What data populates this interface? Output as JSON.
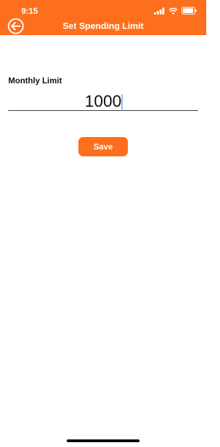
{
  "status_bar": {
    "time": "9:15",
    "icons": [
      "cellular-signal-icon",
      "wifi-icon",
      "battery-icon"
    ]
  },
  "header": {
    "title": "Set Spending Limit",
    "back_icon": "back-arrow-circle-icon",
    "background_color": "#fd6f1c"
  },
  "form": {
    "label": "Monthly Limit",
    "limit_value": "1000"
  },
  "actions": {
    "save_label": "Save"
  },
  "colors": {
    "accent": "#fd6f1c",
    "caret": "#3b6bf5"
  }
}
